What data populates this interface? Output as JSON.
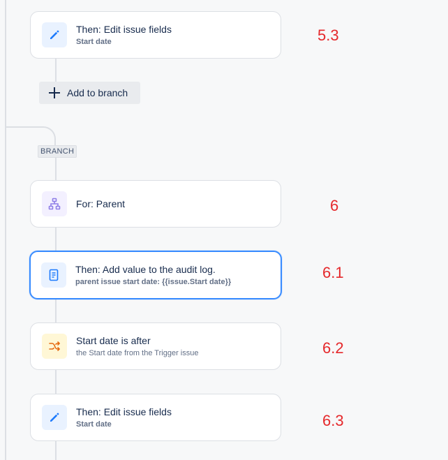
{
  "cards": [
    {
      "title": "Then: Edit issue fields",
      "subtitle": "Start date",
      "icon": "pencil-icon",
      "step": "5.3"
    },
    {
      "title": "For: Parent",
      "subtitle": "",
      "icon": "hierarchy-icon",
      "step": "6"
    },
    {
      "title": "Then: Add value to the audit log.",
      "subtitle": "parent issue start date: {{issue.Start date}}",
      "icon": "document-icon",
      "step": "6.1"
    },
    {
      "title": "Start date is after",
      "subtitle": "the Start date from the Trigger issue",
      "icon": "shuffle-icon",
      "step": "6.2"
    },
    {
      "title": "Then: Edit issue fields",
      "subtitle": "Start date",
      "icon": "pencil-icon",
      "step": "6.3"
    }
  ],
  "add_to_branch": {
    "label": "Add to branch"
  },
  "branch_tag": {
    "label": "BRANCH"
  },
  "colors": {
    "accent_blue": "#1d7afc",
    "selected_border": "#388bff",
    "purple_icon": "#8f7ee7",
    "orange_icon": "#e56910",
    "step_number_red": "#e5282b"
  }
}
